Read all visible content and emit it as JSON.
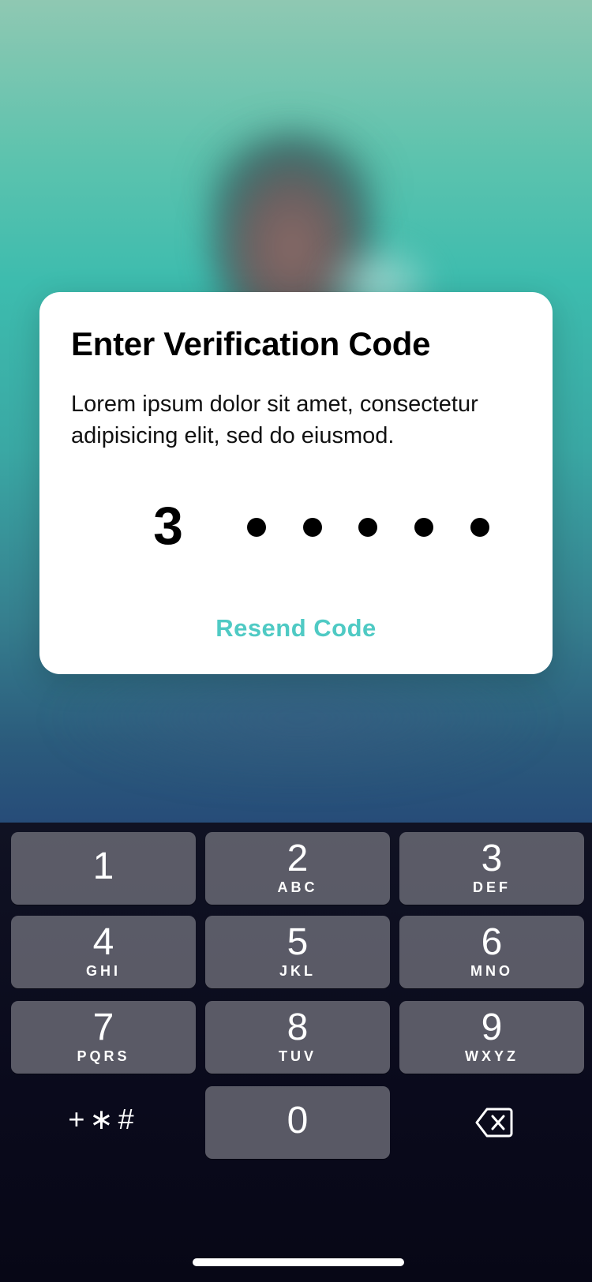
{
  "dialog": {
    "title": "Enter Verification Code",
    "description": "Lorem ipsum dolor sit amet, consectetur adipisicing elit, sed do eiusmod.",
    "code": {
      "entered_digit": "3",
      "masked_count": 5
    },
    "resend_label": "Resend Code",
    "accent_color": "#4fcac4"
  },
  "keypad": {
    "keys": [
      {
        "num": "1",
        "letters": ""
      },
      {
        "num": "2",
        "letters": "ABC"
      },
      {
        "num": "3",
        "letters": "DEF"
      },
      {
        "num": "4",
        "letters": "GHI"
      },
      {
        "num": "5",
        "letters": "JKL"
      },
      {
        "num": "6",
        "letters": "MNO"
      },
      {
        "num": "7",
        "letters": "PQRS"
      },
      {
        "num": "8",
        "letters": "TUV"
      },
      {
        "num": "9",
        "letters": "WXYZ"
      },
      {
        "num": "0",
        "letters": ""
      }
    ],
    "symbols_label": "+∗#",
    "backspace_icon": "backspace-icon"
  }
}
